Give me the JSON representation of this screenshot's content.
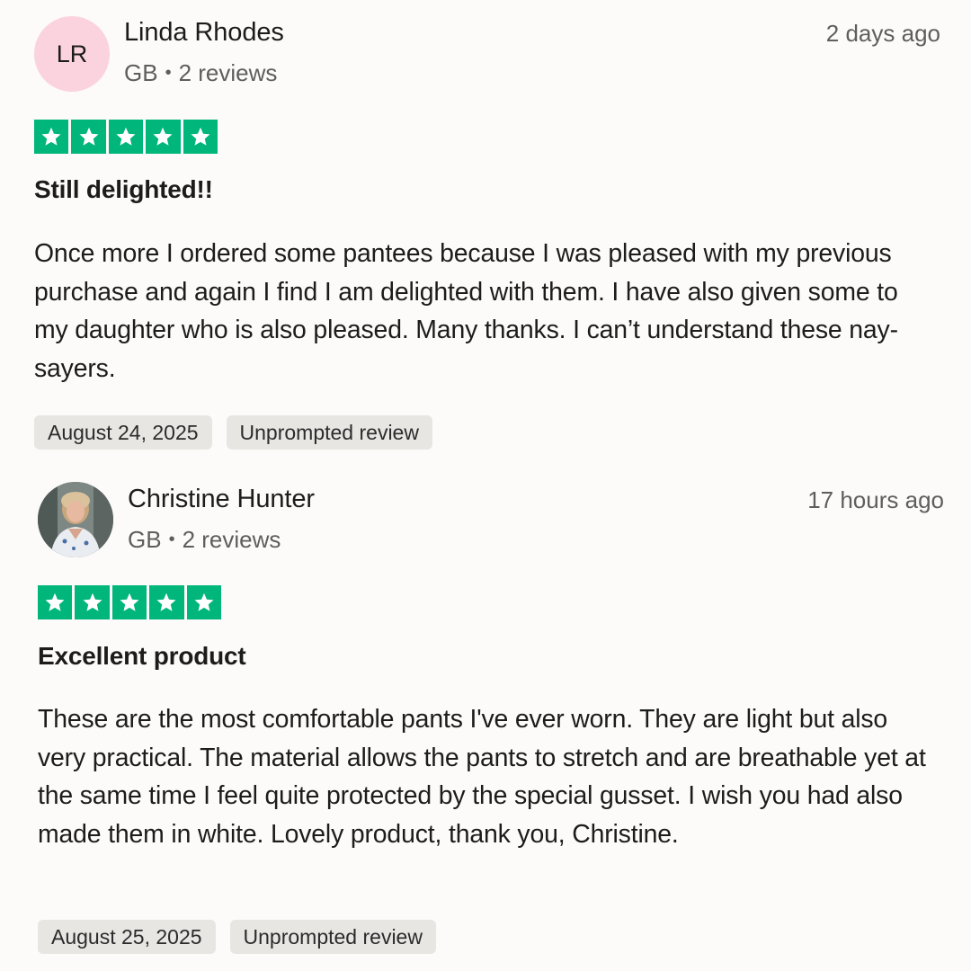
{
  "reviews": [
    {
      "avatar_initials": "LR",
      "avatar_color": "#fbd3df",
      "name": "Linda Rhodes",
      "country": "GB",
      "separator": "•",
      "review_count": "2 reviews",
      "time_ago": "2 days ago",
      "rating": 5,
      "star_color": "#00b67a",
      "title": "Still delighted!!",
      "body": "Once more I ordered some pantees because I was pleased with my previous purchase and again I find I am delighted with them. I have also given some to my daughter who is also pleased. Many thanks. I can’t understand these nay-sayers.",
      "date": "August 24, 2025",
      "badge": "Unprompted review"
    },
    {
      "avatar_initials": "",
      "name": "Christine Hunter",
      "country": "GB",
      "separator": "•",
      "review_count": "2 reviews",
      "time_ago": "17 hours ago",
      "rating": 5,
      "star_color": "#00b67a",
      "title": "Excellent product",
      "body": "These are the most comfortable pants I've ever worn. They are light but also very practical. The material allows the pants to stretch and are breathable yet at the same time I feel quite protected by the special gusset. I wish you had also made them in white. Lovely product, thank you, Christine.",
      "date": "August 25, 2025",
      "badge": "Unprompted review"
    }
  ]
}
